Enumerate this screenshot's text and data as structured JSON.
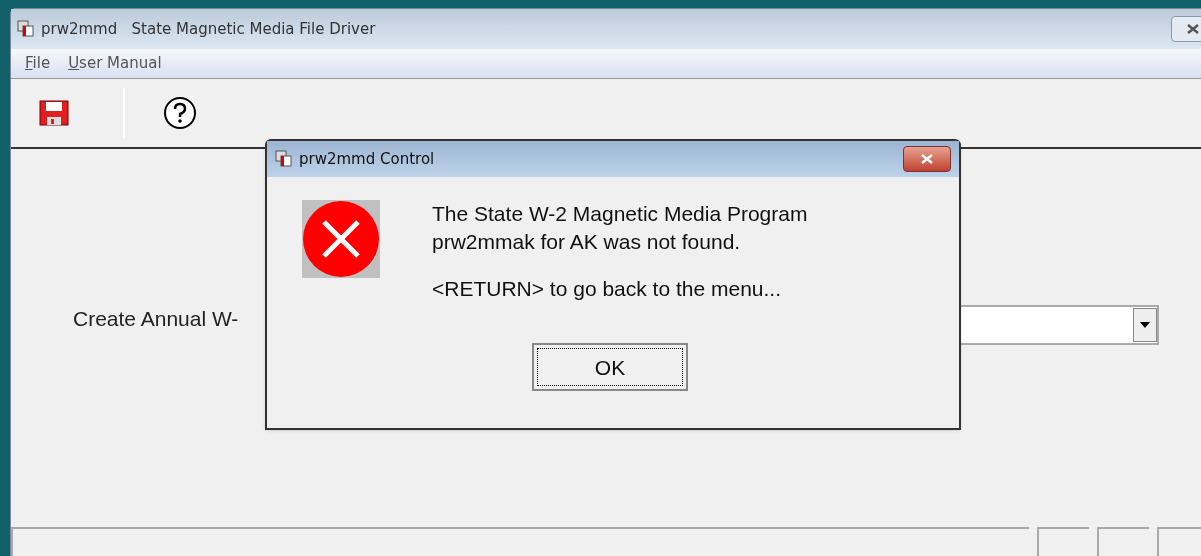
{
  "window": {
    "title": "prw2mmd   State Magnetic Media File Driver"
  },
  "menu": [
    {
      "label": "File"
    },
    {
      "label": "User Manual"
    }
  ],
  "form": {
    "label": "Create Annual W-"
  },
  "dialog": {
    "title": "prw2mmd Control",
    "message": [
      "The State W-2 Magnetic Media Program",
      "prw2mmak for AK was not found."
    ],
    "hint": "<RETURN> to go back to the menu...",
    "button": "OK"
  }
}
